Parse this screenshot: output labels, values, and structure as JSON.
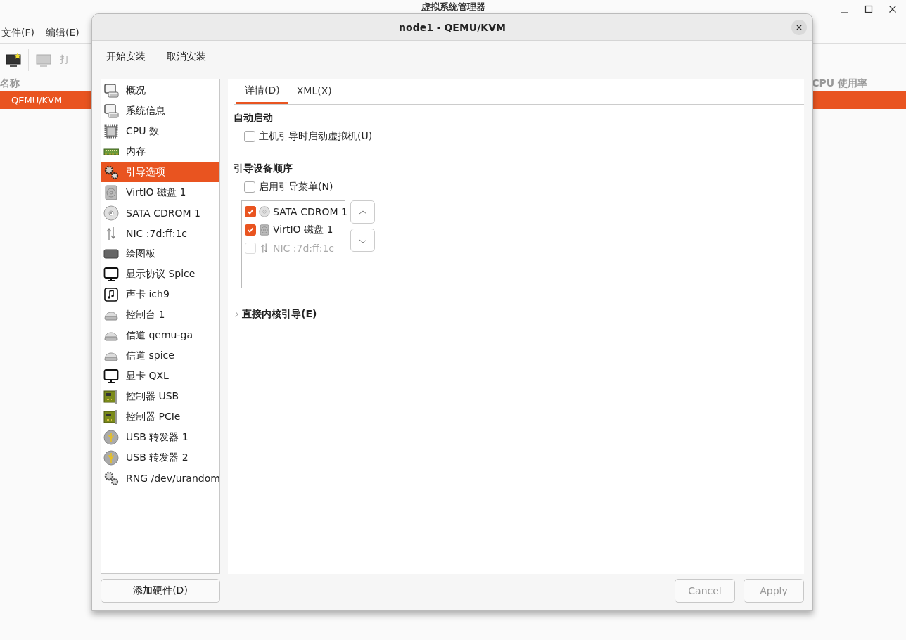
{
  "main_window": {
    "title": "虚拟系统管理器",
    "menu": [
      "文件(F)",
      "编辑(E)"
    ],
    "toolbar": [
      {
        "kind": "new-vm"
      },
      {
        "kind": "monitor",
        "label": "打",
        "disabled": true
      }
    ],
    "columns": [
      "名称",
      "CPU 使用率"
    ],
    "rows": [
      {
        "name": "QEMU/KVM",
        "selected": true
      }
    ]
  },
  "dialog": {
    "title": "node1 - QEMU/KVM",
    "toolbar": [
      "开始安装",
      "取消安装"
    ],
    "hardware": [
      {
        "label": "概况",
        "kind": "monitor-keyboard",
        "selected": false
      },
      {
        "label": "系统信息",
        "kind": "monitor-keyboard",
        "selected": false
      },
      {
        "label": "CPU 数",
        "kind": "chip",
        "selected": false
      },
      {
        "label": "内存",
        "kind": "ram",
        "selected": false
      },
      {
        "label": "引导选项",
        "kind": "gears",
        "selected": true
      },
      {
        "label": "VirtIO 磁盘 1",
        "kind": "disk",
        "selected": false
      },
      {
        "label": "SATA CDROM 1",
        "kind": "cdrom",
        "selected": false
      },
      {
        "label": "NIC :7d:ff:1c",
        "kind": "nic",
        "selected": false
      },
      {
        "label": "绘图板",
        "kind": "tablet",
        "selected": false
      },
      {
        "label": "显示协议 Spice",
        "kind": "display",
        "selected": false
      },
      {
        "label": "声卡 ich9",
        "kind": "sound",
        "selected": false
      },
      {
        "label": "控制台 1",
        "kind": "serial",
        "selected": false
      },
      {
        "label": "信道 qemu-ga",
        "kind": "serial",
        "selected": false
      },
      {
        "label": "信道 spice",
        "kind": "serial",
        "selected": false
      },
      {
        "label": "显卡 QXL",
        "kind": "display",
        "selected": false
      },
      {
        "label": "控制器 USB",
        "kind": "pci",
        "selected": false
      },
      {
        "label": "控制器 PCIe",
        "kind": "pci",
        "selected": false
      },
      {
        "label": "USB 转发器 1",
        "kind": "usb",
        "selected": false
      },
      {
        "label": "USB 转发器 2",
        "kind": "usb",
        "selected": false
      },
      {
        "label": "RNG /dev/urandom",
        "kind": "gears",
        "selected": false
      }
    ],
    "add_button": "添加硬件(D)",
    "tabs": [
      {
        "label": "详情(D)",
        "selected": true
      },
      {
        "label": "XML(X)",
        "selected": false
      }
    ],
    "autostart": {
      "heading": "自动启动",
      "option": {
        "label": "主机引导时启动虚拟机(U)",
        "checked": false
      }
    },
    "boot": {
      "heading": "引导设备顺序",
      "menu_option": {
        "label": "启用引导菜单(N)",
        "checked": false
      },
      "devices": [
        {
          "label": "SATA CDROM 1",
          "kind": "cdrom",
          "checked": true,
          "disabled": false
        },
        {
          "label": "VirtIO 磁盘 1",
          "kind": "disk",
          "checked": true,
          "disabled": false
        },
        {
          "label": "NIC :7d:ff:1c",
          "kind": "nic",
          "checked": false,
          "disabled": true
        }
      ],
      "move_buttons": [
        {
          "kind": "up"
        },
        {
          "kind": "down"
        }
      ]
    },
    "kernel_boot": {
      "label": "直接内核引导(E)",
      "expanded": false
    },
    "buttons": [
      {
        "label": "Cancel",
        "disabled": true
      },
      {
        "label": "Apply",
        "disabled": true
      }
    ]
  }
}
